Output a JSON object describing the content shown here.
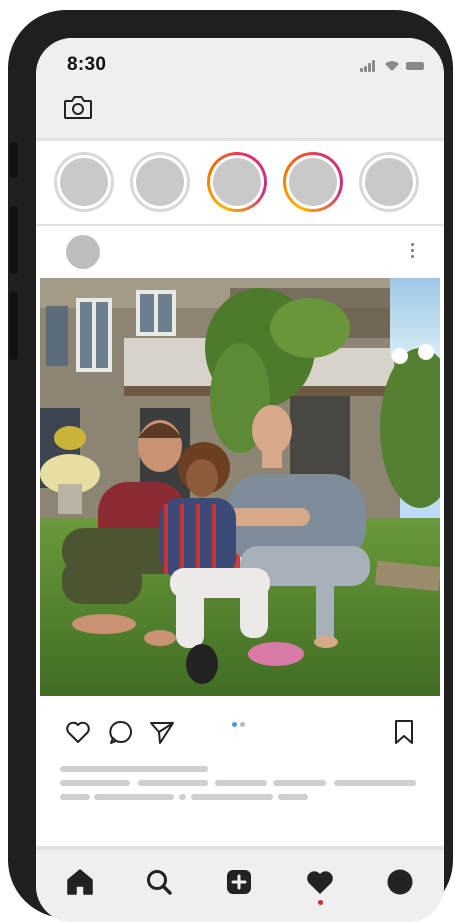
{
  "status_bar": {
    "time": "8:30",
    "icons": [
      "cellular-signal-icon",
      "wifi-icon",
      "battery-icon"
    ]
  },
  "header": {
    "icon": "camera-icon"
  },
  "stories": [
    {
      "ring": "seen"
    },
    {
      "ring": "seen"
    },
    {
      "ring": "new"
    },
    {
      "ring": "new"
    },
    {
      "ring": "seen"
    }
  ],
  "post": {
    "photo_description_icon": "family-photo",
    "actions": [
      "heart-icon",
      "comment-icon",
      "share-icon",
      "bookmark-icon"
    ],
    "carousel": {
      "pages": 2,
      "current": 1
    }
  },
  "bottom_nav": {
    "items": [
      "home-icon",
      "search-icon",
      "new-post-icon",
      "activity-heart-icon",
      "profile-icon"
    ],
    "active": "activity-heart-icon"
  },
  "colors": {
    "accent_red": "#e0262f",
    "carousel_active": "#3d9be9",
    "carousel_inactive": "#b9b9b9",
    "story_ring_gradient": [
      "#f7b500",
      "#e1306c"
    ]
  }
}
